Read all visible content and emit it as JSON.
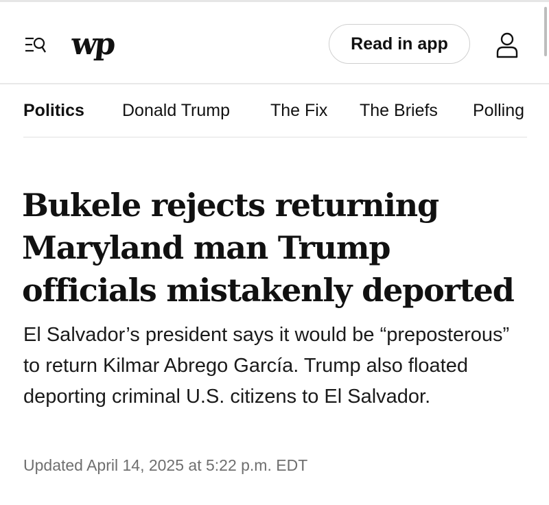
{
  "header": {
    "logo_text": "wp",
    "read_in_app_label": "Read in app",
    "menu_icon": "menu-search-icon",
    "account_icon": "user-account-icon"
  },
  "nav": {
    "items": [
      {
        "label": "Politics",
        "active": true
      },
      {
        "label": "Donald Trump",
        "active": false
      },
      {
        "label": "The Fix",
        "active": false
      },
      {
        "label": "The Briefs",
        "active": false
      },
      {
        "label": "Polling",
        "active": false
      }
    ]
  },
  "article": {
    "headline": "Bukele rejects returning Maryland man Trump officials mistakenly deported",
    "dek": "El Salvador’s president says it would be “preposterous” to return Kilmar Abrego García. Trump also floated deporting criminal U.S. citizens to El Salvador.",
    "updated": "Updated April 14, 2025 at 5:22 p.m. EDT"
  }
}
